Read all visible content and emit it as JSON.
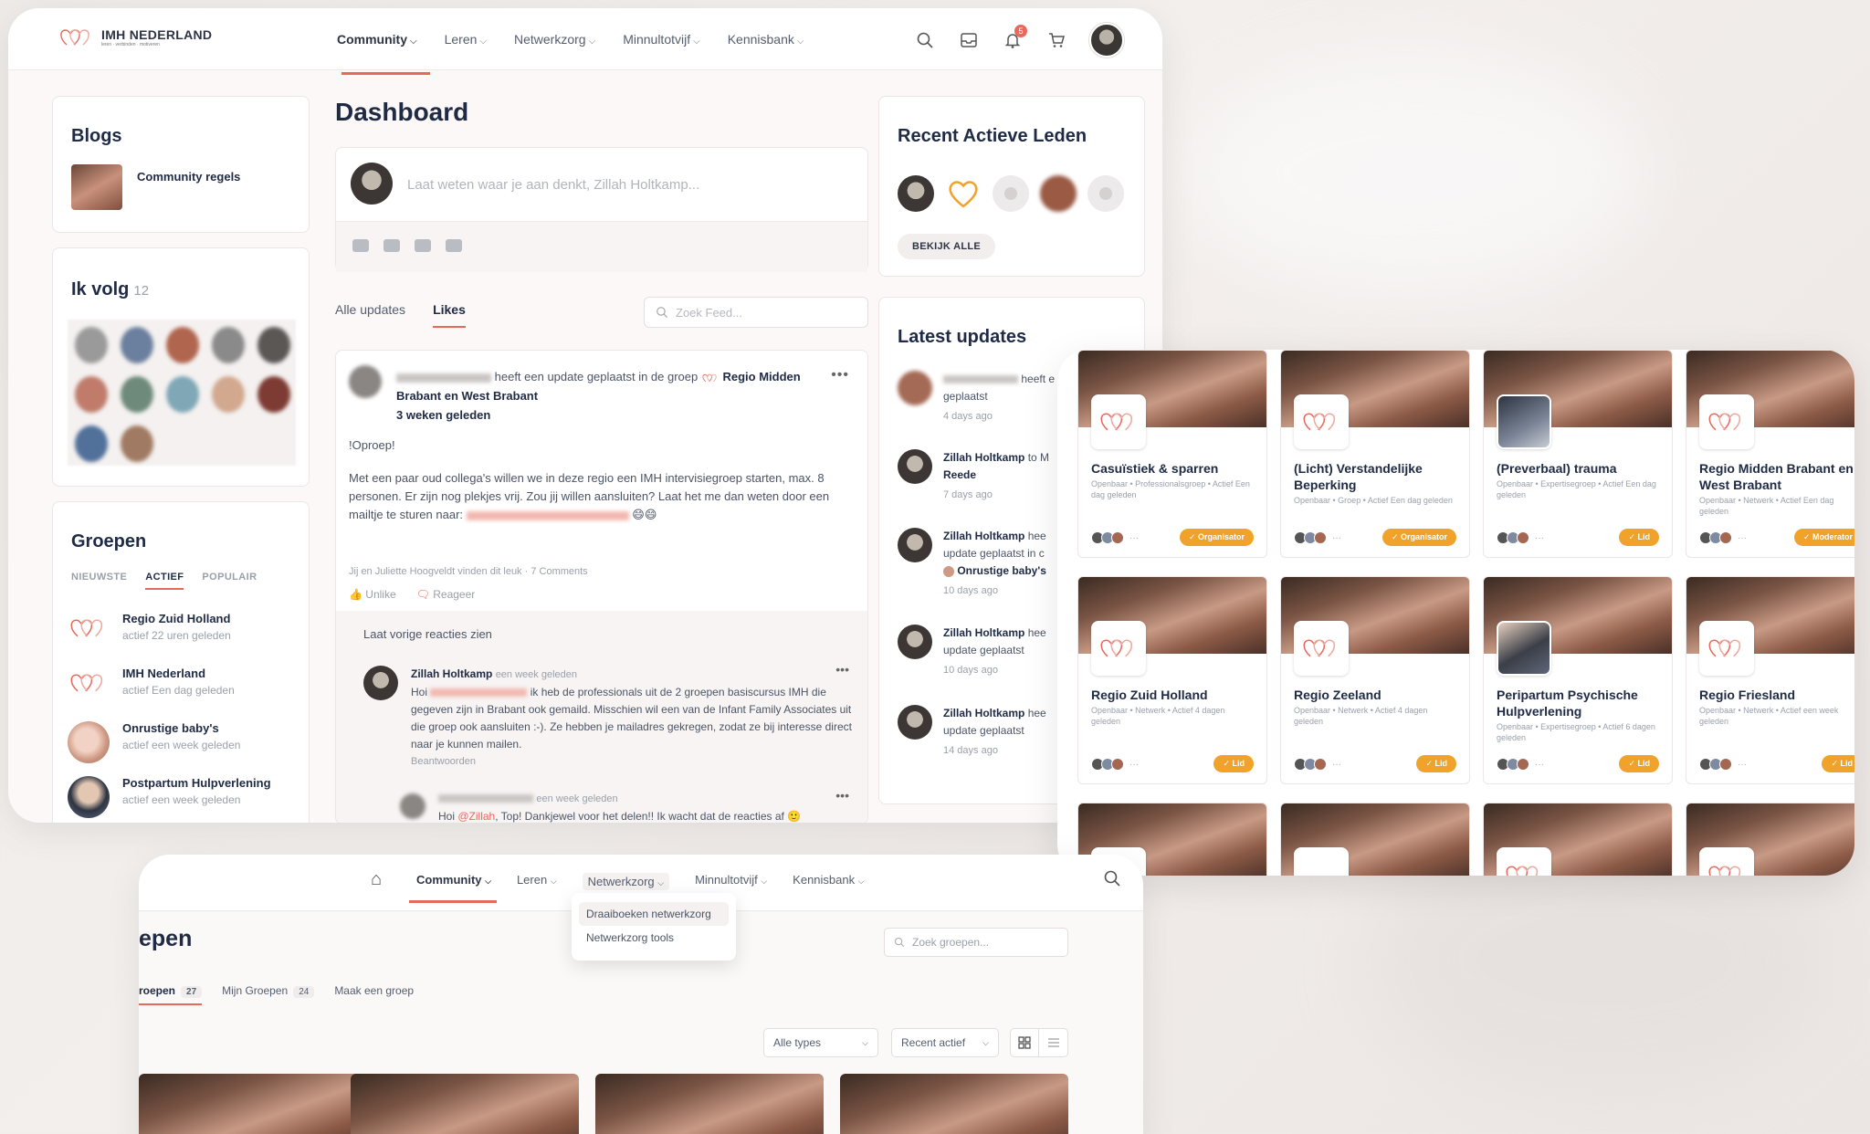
{
  "brand": {
    "name": "IMH NEDERLAND",
    "tagline": "leren · verbinden · motiveren",
    "accent": "#e8695c",
    "badge_color": "#f0a22b"
  },
  "nav": [
    {
      "label": "Community",
      "active": true
    },
    {
      "label": "Leren"
    },
    {
      "label": "Netwerkzorg"
    },
    {
      "label": "Minnultotvijf"
    },
    {
      "label": "Kennisbank"
    }
  ],
  "topbar": {
    "notification_count": "5"
  },
  "blogs": {
    "title": "Blogs",
    "items": [
      {
        "label": "Community regels"
      }
    ]
  },
  "following": {
    "title": "Ik volg",
    "count": "12"
  },
  "groups_widget": {
    "title": "Groepen",
    "tabs": [
      "NIEUWSTE",
      "ACTIEF",
      "POPULAIR"
    ],
    "items": [
      {
        "name": "Regio Zuid Holland",
        "meta": "actief 22 uren geleden"
      },
      {
        "name": "IMH Nederland",
        "meta": "actief Een dag geleden"
      },
      {
        "name": "Onrustige baby's",
        "meta": "actief een week geleden"
      },
      {
        "name": "Postpartum Hulpverlening",
        "meta": "actief een week geleden"
      }
    ]
  },
  "dashboard": {
    "title": "Dashboard",
    "composer_placeholder": "Laat weten waar je aan denkt, Zillah Holtkamp...",
    "feed_tabs": [
      "Alle updates",
      "Likes"
    ],
    "feed_search_placeholder": "Zoek Feed..."
  },
  "post": {
    "header_action": "heeft een update geplaatst in de groep",
    "group": "Regio Midden Brabant en West Brabant",
    "time": "3 weken geleden",
    "heading": "!Oproep!",
    "body": "Met een paar oud collega's willen we in deze regio een IMH intervisiegroep starten, max. 8 personen. Er zijn nog plekjes vrij. Zou jij willen aansluiten? Laat het me dan weten door een mailtje te sturen naar:",
    "emoji": "😄😄",
    "likes_line": "Jij en Juliette Hoogveldt vinden dit leuk · 7 Comments",
    "unlike": "Unlike",
    "reply": "Reageer",
    "load_previous": "Laat vorige reacties zien",
    "comment1": {
      "author": "Zillah Holtkamp",
      "time": "een week geleden",
      "greeting": "Hoi",
      "text": "ik heb de professionals uit de 2 groepen basiscursus IMH die gegeven zijn in Brabant ook gemaild. Misschien wil een van de Infant Family Associates uit die groep ook aansluiten :-). Ze hebben je mailadres gekregen, zodat ze bij interesse direct naar je kunnen mailen.",
      "answered": "Beantwoorden"
    },
    "comment2": {
      "time": "een week geleden",
      "greeting": "Hoi",
      "mention": "@Zillah",
      "text": ", Top! Dankjewel voor het delen!! Ik wacht dat de reacties af 🙂"
    }
  },
  "recent_members": {
    "title": "Recent Actieve Leden",
    "button": "BEKIJK ALLE"
  },
  "latest_updates": {
    "title": "Latest updates",
    "items": [
      {
        "actor": "",
        "action": "heeft e",
        "line2": "geplaatst",
        "time": "4 days ago"
      },
      {
        "actor": "Zillah Holtkamp",
        "action": "to M",
        "line2": "Reede",
        "time": "7 days ago"
      },
      {
        "actor": "Zillah Holtkamp",
        "action": "hee",
        "line2": "update geplaatst in c",
        "line3": "Onrustige baby's",
        "time": "10 days ago"
      },
      {
        "actor": "Zillah Holtkamp",
        "action": "hee",
        "line2": "update geplaatst",
        "time": "10 days ago"
      },
      {
        "actor": "Zillah Holtkamp",
        "action": "hee",
        "line2": "update geplaatst",
        "time": "14 days ago"
      }
    ]
  },
  "group_cards": [
    {
      "name": "Casuïstiek & sparren",
      "meta": "Openbaar • Professionalsgroep • Actief Een dag geleden",
      "badge": "✓ Organisator"
    },
    {
      "name": "(Licht) Verstandelijke Beperking",
      "meta": "Openbaar • Groep • Actief Een dag geleden",
      "badge": "✓ Organisator"
    },
    {
      "name": "(Preverbaal) trauma",
      "meta": "Openbaar • Expertisegroep • Actief Een dag geleden",
      "badge": "✓ Lid"
    },
    {
      "name": "Regio Midden Brabant en West Brabant",
      "meta": "Openbaar • Netwerk • Actief Een dag geleden",
      "badge": "✓ Moderator"
    },
    {
      "name": "Regio Zuid Holland",
      "meta": "Openbaar • Netwerk • Actief 4 dagen geleden",
      "badge": "✓ Lid"
    },
    {
      "name": "Regio Zeeland",
      "meta": "Openbaar • Netwerk • Actief 4 dagen geleden",
      "badge": "✓ Lid"
    },
    {
      "name": "Peripartum Psychische Hulpverlening",
      "meta": "Openbaar • Expertisegroep • Actief 6 dagen geleden",
      "badge": "✓ Lid"
    },
    {
      "name": "Regio Friesland",
      "meta": "Openbaar • Netwerk • Actief een week geleden",
      "badge": "✓ Lid"
    }
  ],
  "groups_page": {
    "title_fragment": "epen",
    "tabs": [
      {
        "label": "roepen",
        "count": "27"
      },
      {
        "label": "Mijn Groepen",
        "count": "24"
      },
      {
        "label": "Maak een groep"
      }
    ],
    "search_placeholder": "Zoek groepen...",
    "filter_types": "Alle types",
    "filter_sort": "Recent actief",
    "dropdown": [
      "Draaiboeken netwerkzorg",
      "Netwerkzorg tools"
    ]
  }
}
